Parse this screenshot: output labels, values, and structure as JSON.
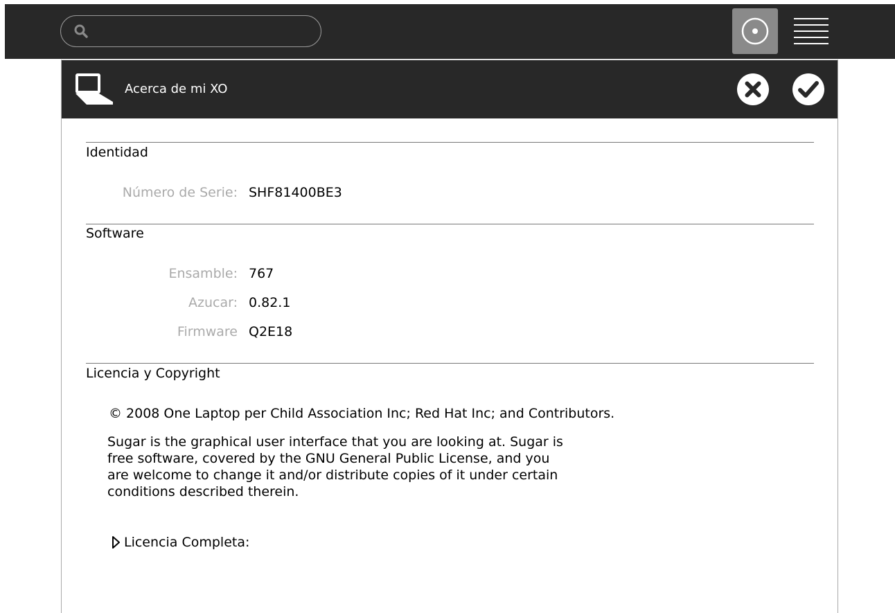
{
  "frame": {
    "search": {
      "placeholder": "",
      "value": ""
    },
    "buttons": {
      "view_icon": "circle-dot-icon",
      "menu_icon": "hamburger-icon"
    }
  },
  "panel": {
    "title": "Acerca de mi XO",
    "icon": "laptop-icon",
    "actions": {
      "cancel_icon": "close-icon",
      "accept_icon": "checkmark-icon"
    }
  },
  "sections": {
    "identity": {
      "title": "Identidad",
      "serial_label": "Número de Serie:",
      "serial_value": "SHF81400BE3"
    },
    "software": {
      "title": "Software",
      "build_label": "Ensamble:",
      "build_value": "767",
      "sugar_label": "Azucar:",
      "sugar_value": "0.82.1",
      "firmware_label": "Firmware",
      "firmware_value": "Q2E18"
    },
    "license": {
      "title": "Licencia y Copyright",
      "copyright": "© 2008 One Laptop per Child Association Inc; Red Hat Inc; and Contributors.",
      "text": "Sugar is the graphical user interface that you are looking at. Sugar is free software, covered by the GNU General Public License, and you are welcome to change it and/or distribute copies of it under certain conditions described therein.",
      "full_license_label": "Licencia Completa:"
    }
  },
  "colors": {
    "frame_bg": "#282828",
    "label_gray": "#aaaaaa",
    "rule": "#777777",
    "selected_button": "#8a8a8a"
  }
}
